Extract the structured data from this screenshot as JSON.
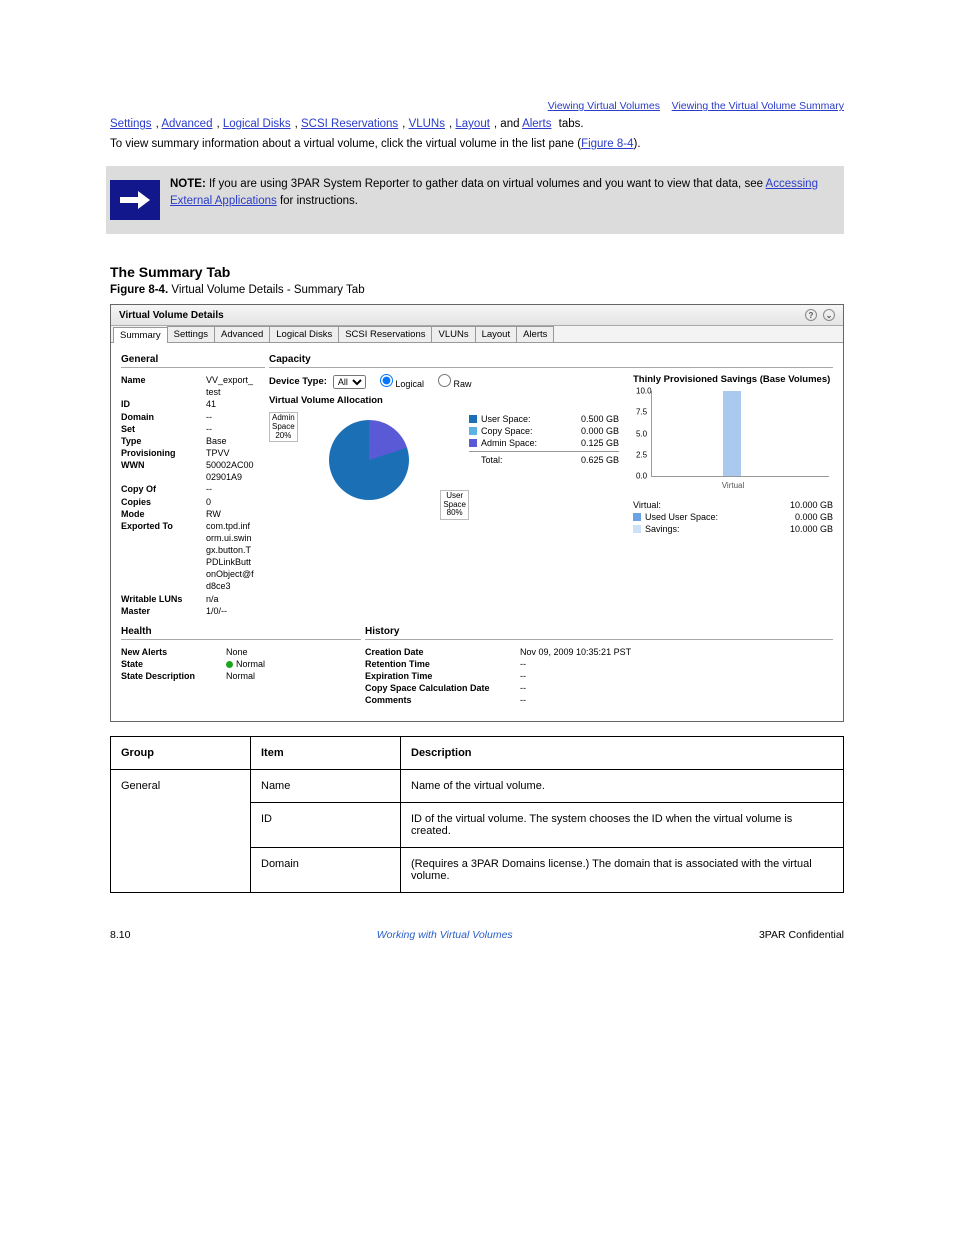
{
  "header": {
    "right1": "Viewing Virtual Volumes",
    "right2": "Viewing the Virtual Volume Summary"
  },
  "intro_links": [
    "Settings",
    "Advanced",
    "Logical Disks",
    "SCSI Reservations",
    "VLUNs",
    "Layout",
    "Alerts"
  ],
  "intro_tail": "tabs.",
  "body1": "To view summary information about a virtual volume, click the virtual volume in the list pane (",
  "body1_link": "Figure 8-4",
  "body1_tail": ").",
  "note": {
    "title": "NOTE:",
    "text_a": " If you are using 3PAR System Reporter to gather data on virtual volumes and you want to view that data, see ",
    "link": "Accessing External Applications",
    "text_b": " for instructions."
  },
  "section_title": "The Summary Tab",
  "fig_caption_label": "Figure 8-4.",
  "fig_caption_text": " Virtual Volume Details - Summary Tab",
  "panel": {
    "title": "Virtual Volume Details",
    "tabs": [
      "Summary",
      "Settings",
      "Advanced",
      "Logical Disks",
      "SCSI Reservations",
      "VLUNs",
      "Layout",
      "Alerts"
    ],
    "general_title": "General",
    "general": [
      {
        "k": "Name",
        "v": "VV_export_test"
      },
      {
        "k": "ID",
        "v": "41"
      },
      {
        "k": "Domain",
        "v": "--"
      },
      {
        "k": "Set",
        "v": "--"
      },
      {
        "k": "Type",
        "v": "Base"
      },
      {
        "k": "Provisioning",
        "v": "TPVV"
      },
      {
        "k": "WWN",
        "v": "50002AC0002901A9"
      },
      {
        "k": "Copy Of",
        "v": "--"
      },
      {
        "k": "Copies",
        "v": "0"
      },
      {
        "k": "Mode",
        "v": "RW"
      },
      {
        "k": "Exported To",
        "v": "com.tpd.inform.ui.swingx.button.TPDLinkButtonObject@fd8ce3"
      },
      {
        "k": "Writable LUNs",
        "v": "n/a"
      },
      {
        "k": "Master",
        "v": "1/0/--"
      }
    ],
    "capacity_title": "Capacity",
    "device_type_label": "Device Type:",
    "device_type_options": [
      "All"
    ],
    "radio_logical": "Logical",
    "radio_raw": "Raw",
    "vva_title": "Virtual Volume Allocation",
    "pie_admin": "Admin\nSpace\n20%",
    "pie_user": "User\nSpace\n80%",
    "legend": [
      {
        "label": "User Space:",
        "color": "#1a6fb5",
        "value": "0.500 GB"
      },
      {
        "label": "Copy Space:",
        "color": "#5db1e3",
        "value": "0.000 GB"
      },
      {
        "label": "Admin Space:",
        "color": "#5a5ad6",
        "value": "0.125 GB"
      }
    ],
    "legend_total_label": "Total:",
    "legend_total_value": "0.625 GB",
    "tp_title": "Thinly Provisioned Savings (Base Volumes)",
    "tp_ticks": [
      "10.0",
      "7.5",
      "5.0",
      "2.5",
      "0.0"
    ],
    "tp_xlabel": "Virtual",
    "tp_legend": [
      {
        "label": "Virtual:",
        "color": "",
        "value": "10.000 GB"
      },
      {
        "label": "Used User Space:",
        "color": "#6aa2e6",
        "value": "0.000 GB"
      },
      {
        "label": "Savings:",
        "color": "#cde0f5",
        "value": "10.000 GB"
      }
    ],
    "health_title": "Health",
    "health": [
      {
        "k": "New Alerts",
        "v": "None"
      },
      {
        "k": "State",
        "v": "Normal",
        "dot": true
      },
      {
        "k": "State Description",
        "v": "Normal"
      }
    ],
    "history_title": "History",
    "history": [
      {
        "k": "Creation Date",
        "v": "Nov 09, 2009 10:35:21 PST"
      },
      {
        "k": "Retention Time",
        "v": "--"
      },
      {
        "k": "Expiration Time",
        "v": "--"
      },
      {
        "k": "Copy Space Calculation Date",
        "v": "--"
      },
      {
        "k": "Comments",
        "v": "--"
      }
    ]
  },
  "chart_data": [
    {
      "type": "pie",
      "title": "Virtual Volume Allocation",
      "series": [
        {
          "name": "User Space",
          "value_gb": 0.5,
          "percent": 80
        },
        {
          "name": "Copy Space",
          "value_gb": 0.0,
          "percent": 0
        },
        {
          "name": "Admin Space",
          "value_gb": 0.125,
          "percent": 20
        }
      ],
      "total_gb": 0.625
    },
    {
      "type": "bar",
      "title": "Thinly Provisioned Savings (Base Volumes)",
      "categories": [
        "Virtual"
      ],
      "series": [
        {
          "name": "Virtual",
          "values": [
            10.0
          ]
        },
        {
          "name": "Used User Space",
          "values": [
            0.0
          ]
        },
        {
          "name": "Savings",
          "values": [
            10.0
          ]
        }
      ],
      "ylim": [
        0.0,
        10.0
      ],
      "yticks": [
        0.0,
        2.5,
        5.0,
        7.5,
        10.0
      ],
      "xlabel": "",
      "ylabel": ""
    }
  ],
  "table": {
    "headers": [
      "Group",
      "Item",
      "Description"
    ],
    "rows": [
      {
        "g": "General",
        "i": "Name",
        "d": "Name of the virtual volume."
      },
      {
        "g": "",
        "i": "ID",
        "d": "ID of the virtual volume. The system chooses the ID when the virtual volume is created."
      },
      {
        "g": "",
        "i": "Domain",
        "d": "(Requires a 3PAR Domains license.) The domain that is associated with the virtual volume."
      }
    ]
  },
  "footer": {
    "left": "8.10",
    "mid": "Working with Virtual Volumes",
    "right": "3PAR Confidential"
  }
}
